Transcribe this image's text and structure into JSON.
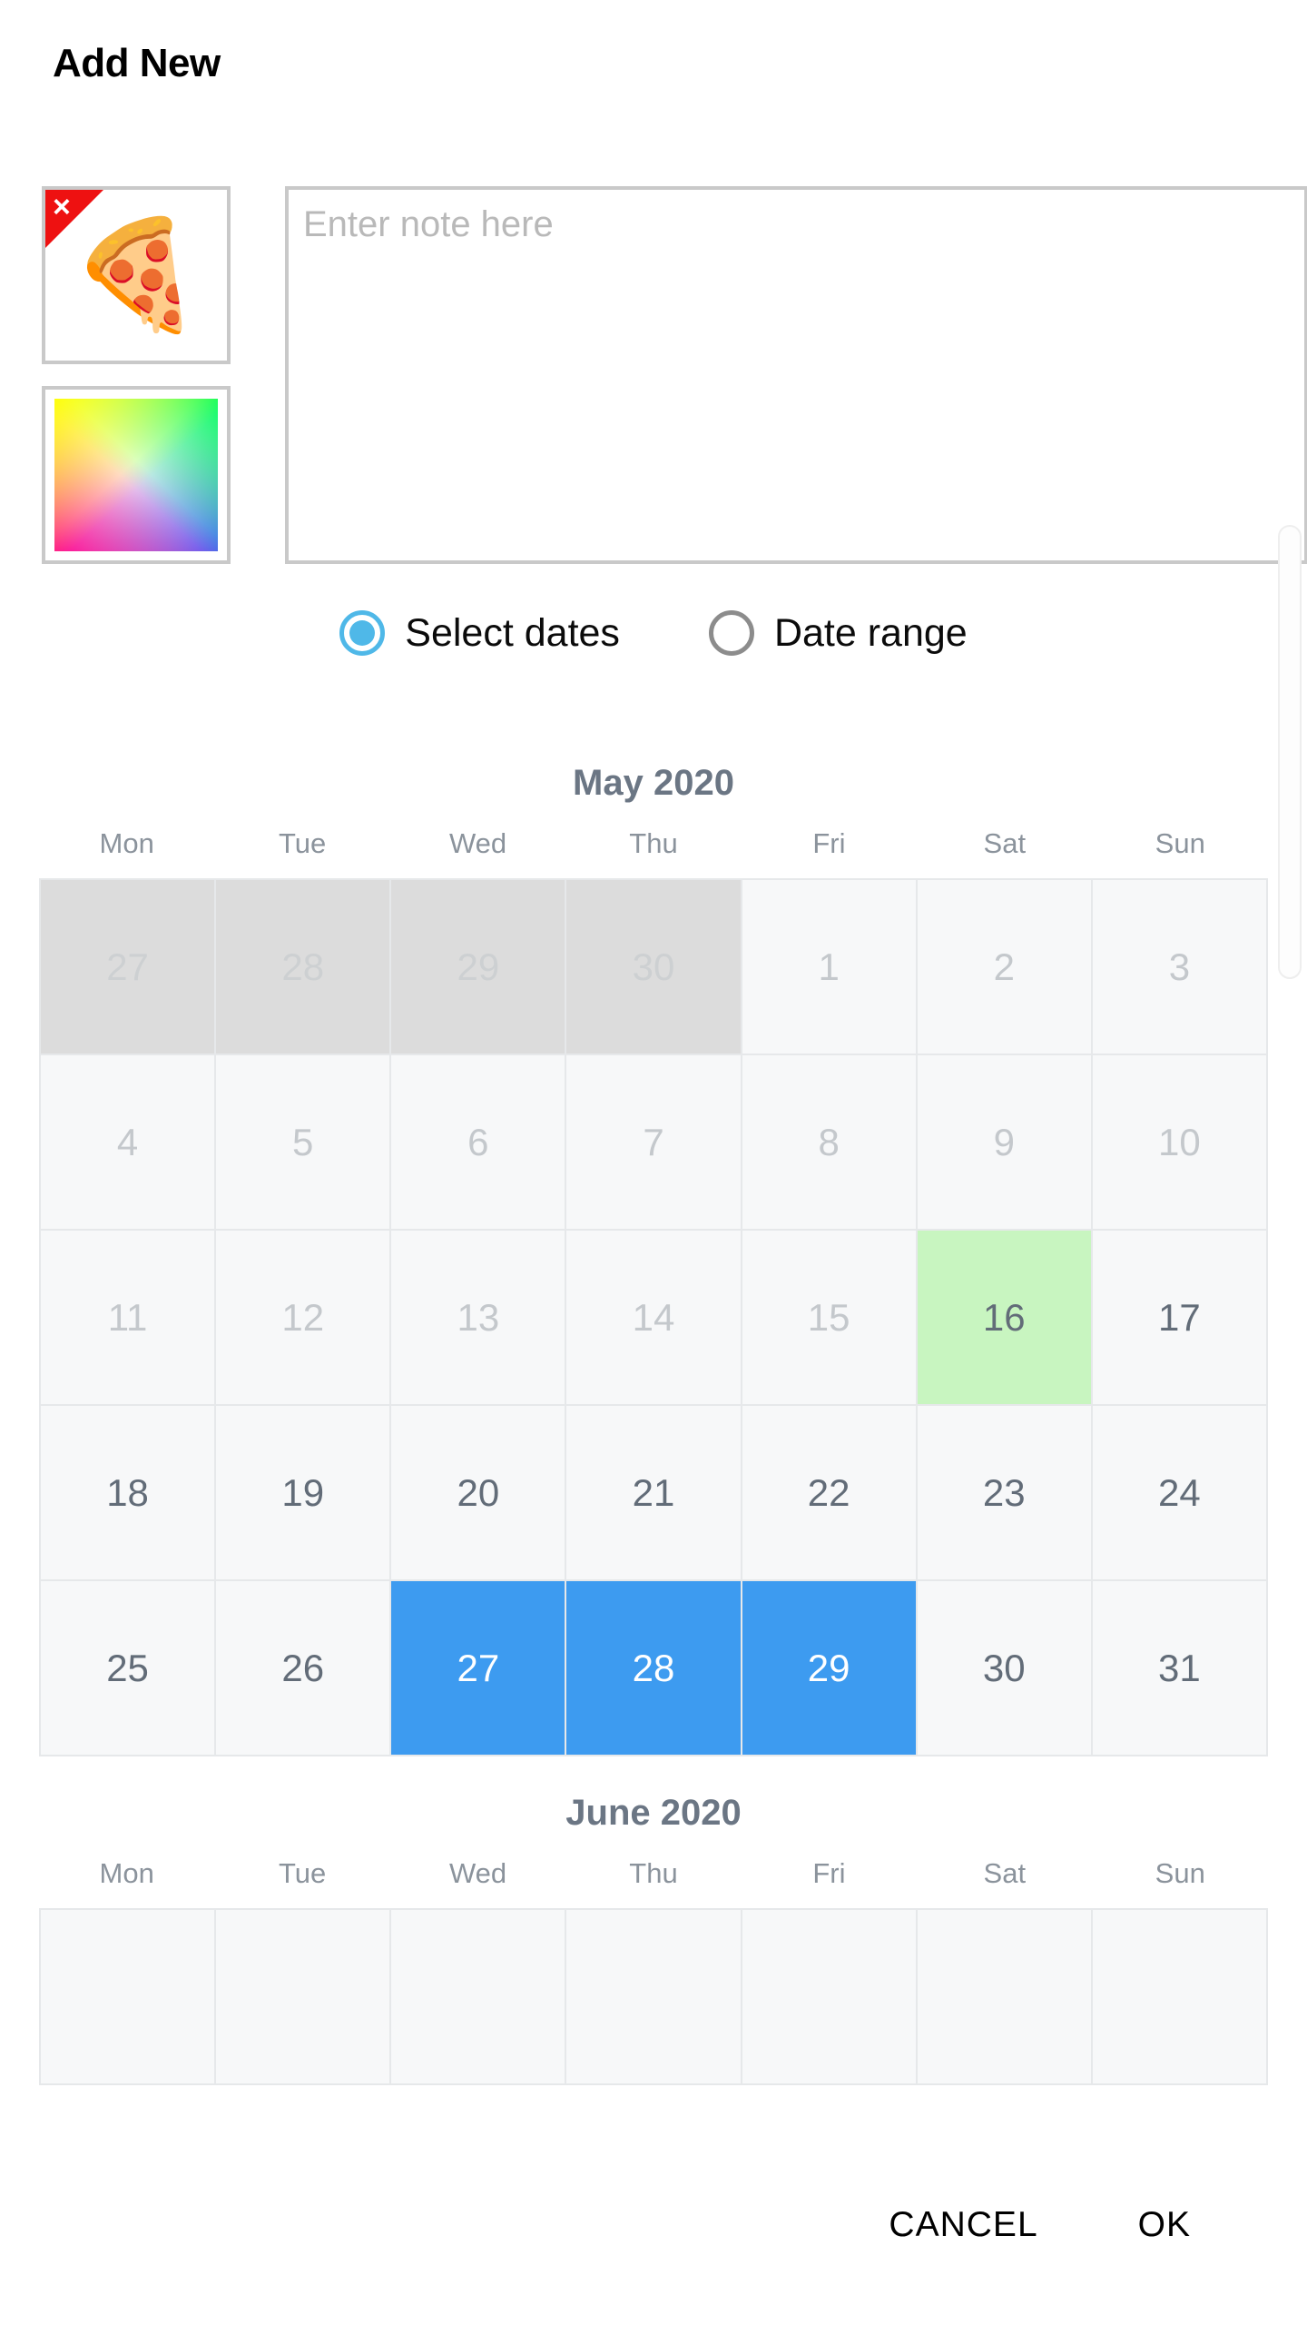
{
  "dialog": {
    "title": "Add New"
  },
  "thumbnails": {
    "image": {
      "emoji": "🍕",
      "delete_glyph": "×",
      "delete_badge_color": "#ee1111"
    },
    "color_picker": {
      "corner_colors": {
        "top_left": "#ffff00",
        "top_right": "#00ff5a",
        "bottom_left": "#ff008c",
        "bottom_right": "#3c5aff",
        "center": "#ffffff"
      }
    }
  },
  "note": {
    "value": "",
    "placeholder": "Enter note here"
  },
  "mode": {
    "options": [
      {
        "label": "Select dates",
        "checked": true
      },
      {
        "label": "Date range",
        "checked": false
      }
    ],
    "accent_color": "#4fb8e8",
    "inactive_color": "#8c8c8c"
  },
  "calendar": {
    "weekdays": [
      "Mon",
      "Tue",
      "Wed",
      "Thu",
      "Fri",
      "Sat",
      "Sun"
    ],
    "colors": {
      "selected": "#3d9bf0",
      "highlight": "#c8f5c0",
      "past_block": "#dcdcdc",
      "cell": "#f7f8f9",
      "month_title": "#6b7684"
    },
    "months": [
      {
        "title": "May 2020",
        "rows": [
          [
            {
              "label": "27",
              "state": "past"
            },
            {
              "label": "28",
              "state": "past"
            },
            {
              "label": "29",
              "state": "past"
            },
            {
              "label": "30",
              "state": "past"
            },
            {
              "label": "1",
              "state": "muted"
            },
            {
              "label": "2",
              "state": "muted"
            },
            {
              "label": "3",
              "state": "muted"
            }
          ],
          [
            {
              "label": "4",
              "state": "muted"
            },
            {
              "label": "5",
              "state": "muted"
            },
            {
              "label": "6",
              "state": "muted"
            },
            {
              "label": "7",
              "state": "muted"
            },
            {
              "label": "8",
              "state": "muted"
            },
            {
              "label": "9",
              "state": "muted"
            },
            {
              "label": "10",
              "state": "muted"
            }
          ],
          [
            {
              "label": "11",
              "state": "muted"
            },
            {
              "label": "12",
              "state": "muted"
            },
            {
              "label": "13",
              "state": "muted"
            },
            {
              "label": "14",
              "state": "muted"
            },
            {
              "label": "15",
              "state": "muted"
            },
            {
              "label": "16",
              "state": "green"
            },
            {
              "label": "17",
              "state": "normal"
            }
          ],
          [
            {
              "label": "18",
              "state": "normal"
            },
            {
              "label": "19",
              "state": "normal"
            },
            {
              "label": "20",
              "state": "normal"
            },
            {
              "label": "21",
              "state": "normal"
            },
            {
              "label": "22",
              "state": "normal"
            },
            {
              "label": "23",
              "state": "normal"
            },
            {
              "label": "24",
              "state": "normal"
            }
          ],
          [
            {
              "label": "25",
              "state": "normal"
            },
            {
              "label": "26",
              "state": "normal"
            },
            {
              "label": "27",
              "state": "sel"
            },
            {
              "label": "28",
              "state": "sel"
            },
            {
              "label": "29",
              "state": "sel"
            },
            {
              "label": "30",
              "state": "normal"
            },
            {
              "label": "31",
              "state": "normal"
            }
          ]
        ]
      },
      {
        "title": "June 2020",
        "rows": [
          [
            {
              "label": "",
              "state": "normal"
            },
            {
              "label": "",
              "state": "normal"
            },
            {
              "label": "",
              "state": "normal"
            },
            {
              "label": "",
              "state": "normal"
            },
            {
              "label": "",
              "state": "normal"
            },
            {
              "label": "",
              "state": "normal"
            },
            {
              "label": "",
              "state": "normal"
            }
          ]
        ]
      }
    ]
  },
  "footer": {
    "cancel_label": "CANCEL",
    "ok_label": "OK"
  }
}
